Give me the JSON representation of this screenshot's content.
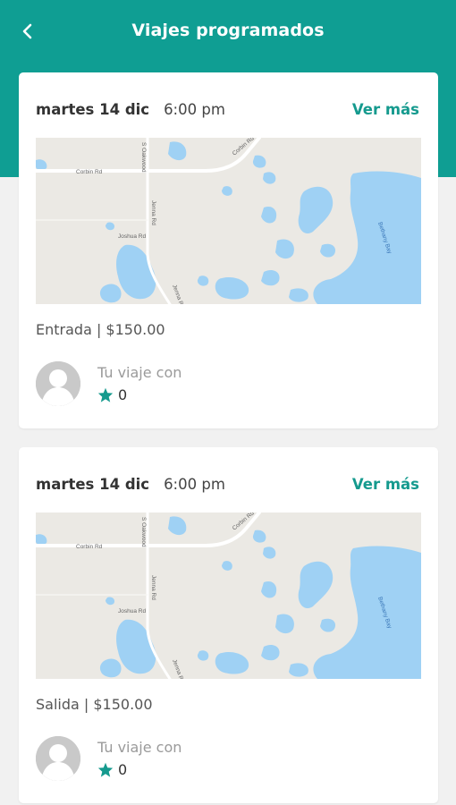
{
  "header": {
    "title": "Viajes programados",
    "back_icon": "chevron-left-icon"
  },
  "colors": {
    "primary": "#0f9e93",
    "link": "#159a8e",
    "water": "#9fd1f4",
    "background": "#f1f1f1"
  },
  "trips": [
    {
      "day": "martes 14 dic",
      "time": "6:00 pm",
      "more_label": "Ver más",
      "summary": "Entrada | $150.00",
      "driver_label": "Tu viaje con",
      "rating": "0",
      "map_labels": {
        "road_1": "Corbin Rd",
        "road_2": "Corbin Rd",
        "road_3": "S Oakwood",
        "road_4": "Jenna Rd",
        "road_5": "Joshua Rd",
        "road_6": "Jenna Rd",
        "bay": "Bethany Bay"
      }
    },
    {
      "day": "martes 14 dic",
      "time": "6:00 pm",
      "more_label": "Ver más",
      "summary": "Salida | $150.00",
      "driver_label": "Tu viaje con",
      "rating": "0",
      "map_labels": {
        "road_1": "Corbin Rd",
        "road_2": "Corbin Rd",
        "road_3": "S Oakwood",
        "road_4": "Jenna Rd",
        "road_5": "Joshua Rd",
        "road_6": "Jenna Rd",
        "bay": "Bethany Bay"
      }
    }
  ]
}
